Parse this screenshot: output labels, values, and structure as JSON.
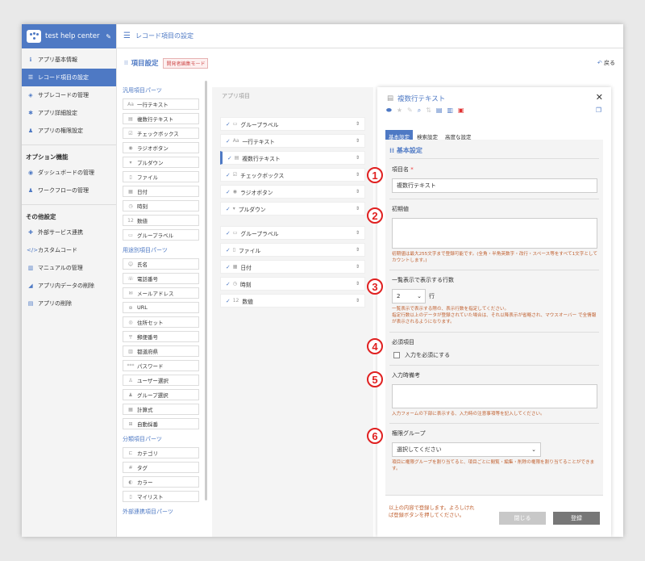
{
  "sidebar": {
    "title": "test help center",
    "items": [
      {
        "label": "アプリ基本情報",
        "icon": "info-icon"
      },
      {
        "label": "レコード項目の設定",
        "icon": "list-icon"
      },
      {
        "label": "サブレコードの管理",
        "icon": "layers-icon"
      },
      {
        "label": "アプリ詳細設定",
        "icon": "gear-icon"
      },
      {
        "label": "アプリの権限設定",
        "icon": "users-icon"
      }
    ],
    "section2": "オプション機能",
    "items2": [
      {
        "label": "ダッシュボードの管理",
        "icon": "dashboard-icon"
      },
      {
        "label": "ワークフローの管理",
        "icon": "workflow-icon"
      }
    ],
    "section3": "その他設定",
    "items3": [
      {
        "label": "外部サービス連携",
        "icon": "puzzle-icon"
      },
      {
        "label": "カスタムコード",
        "icon": "code-icon"
      },
      {
        "label": "マニュアルの管理",
        "icon": "book-icon"
      },
      {
        "label": "アプリ内データの削除",
        "icon": "delete-data-icon"
      },
      {
        "label": "アプリの削除",
        "icon": "trash-icon"
      }
    ]
  },
  "topbar": {
    "title": "レコード項目の設定"
  },
  "subhead": {
    "title": "項目設定",
    "badge": "開発者編集モード",
    "back": "戻る"
  },
  "parts": {
    "general_title": "汎用項目パーツ",
    "general": [
      "一行テキスト",
      "複数行テキスト",
      "チェックボックス",
      "ラジオボタン",
      "プルダウン",
      "ファイル",
      "日付",
      "時刻",
      "数値",
      "グループラベル"
    ],
    "special_title": "用途別項目パーツ",
    "special": [
      "氏名",
      "電話番号",
      "メールアドレス",
      "URL",
      "住所セット",
      "郵便番号",
      "都道府県",
      "パスワード",
      "ユーザー選択",
      "グループ選択",
      "計算式",
      "自動採番"
    ],
    "category_title": "分類項目パーツ",
    "category": [
      "カテゴリ",
      "タグ",
      "カラー",
      "マイリスト"
    ],
    "external_title": "外部連携項目パーツ"
  },
  "app_fields": {
    "caption": "アプリ項目",
    "group1": [
      "グループラベル",
      "一行テキスト",
      "複数行テキスト",
      "チェックボックス",
      "ラジオボタン",
      "プルダウン"
    ],
    "group2": [
      "グループラベル",
      "ファイル",
      "日付",
      "時刻",
      "数値"
    ]
  },
  "panel": {
    "title": "複数行テキスト",
    "tabs": [
      "基本設定",
      "検索設定",
      "高度な設定"
    ],
    "section": "基本設定",
    "name_label": "項目名",
    "name_value": "複数行テキスト",
    "default_label": "初期値",
    "default_note": "初期値は最大255文字まで登録可能です。(全角・半角英数字・改行・スペース等をすべて1文字としてカウントします。)",
    "rows_label": "一覧表示で表示する行数",
    "rows_value": "2",
    "rows_unit": "行",
    "rows_note": "一覧表示で表示する際の、表示行数を指定してください。\n指定行数以上のデータが登録されていた場合は、それ以降表示が省略され、マウスオーバー で全情報が表示されるようになります。",
    "required_label": "必須項目",
    "required_check": "入力を必須にする",
    "memo_label": "入力時備考",
    "memo_note": "入力フォームの下部に表示する、入力時の注意事項等を記入してください。",
    "perm_label": "権限グループ",
    "perm_value": "選択してください",
    "perm_note": "項目に権限グループを割り当てると、項目ごとに閲覧・編集・削除の権限を割り当てることができます。",
    "footer_msg": "以上の内容で登録します。よろしければ登録ボタンを押してください。",
    "close_btn": "閉じる",
    "register_btn": "登録"
  },
  "markers": [
    "1",
    "2",
    "3",
    "4",
    "5",
    "6"
  ],
  "colors": {
    "accent": "#4e79c4",
    "marker": "#e02020"
  }
}
